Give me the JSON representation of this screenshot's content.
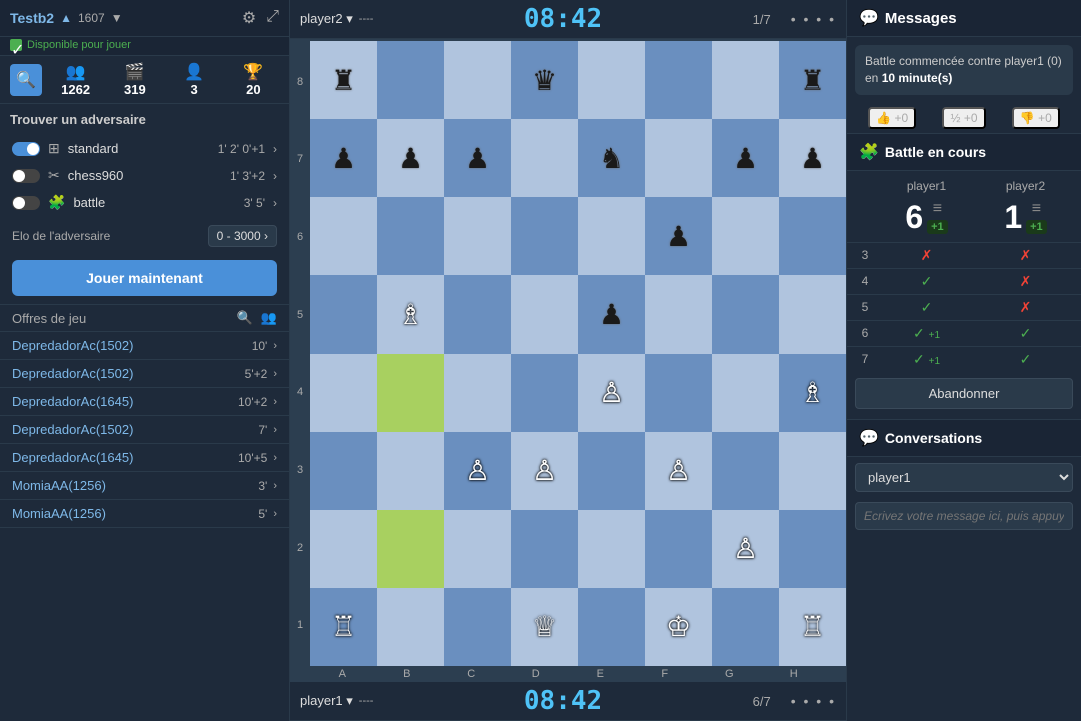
{
  "user": {
    "name": "Testb2",
    "rating": "1607",
    "dropdown_arrow": "▼",
    "available_label": "Disponible pour jouer"
  },
  "stats": [
    {
      "icon": "👥",
      "value": "1262",
      "label": "people"
    },
    {
      "icon": "🎬",
      "value": "319",
      "label": "games"
    },
    {
      "icon": "👤★",
      "value": "3",
      "label": "friends"
    },
    {
      "icon": "🏆",
      "value": "20",
      "label": "trophy"
    }
  ],
  "find_opponent_label": "Trouver un adversaire",
  "game_modes": [
    {
      "enabled": true,
      "icon": "⊞",
      "name": "standard",
      "time": "1'  2'  0'+1",
      "has_arrow": true
    },
    {
      "enabled": false,
      "icon": "✂",
      "name": "chess960",
      "time": "1'  3'+2",
      "has_arrow": true
    },
    {
      "enabled": false,
      "icon": "🧩",
      "name": "battle",
      "time": "3'  5'",
      "has_arrow": true
    }
  ],
  "elo_label": "Elo de l'adversaire",
  "elo_range": "0 - 3000",
  "play_button": "Jouer maintenant",
  "offers_title": "Offres de jeu",
  "offers": [
    {
      "name": "DepredadorAc(1502)",
      "time": "10'",
      "has_arrow": true
    },
    {
      "name": "DepredadorAc(1502)",
      "time": "5'+2",
      "has_arrow": true
    },
    {
      "name": "DepredadorAc(1645)",
      "time": "10'+2",
      "has_arrow": true
    },
    {
      "name": "DepredadorAc(1502)",
      "time": "7'",
      "has_arrow": true
    },
    {
      "name": "DepredadorAc(1645)",
      "time": "10'+5",
      "has_arrow": true
    },
    {
      "name": "MomiaAA(1256)",
      "time": "3'",
      "has_arrow": true
    },
    {
      "name": "MomiaAA(1256)",
      "time": "5'",
      "has_arrow": true
    }
  ],
  "board": {
    "top_player": "player2",
    "bottom_player": "player1",
    "top_timer": "08:42",
    "bottom_timer": "08:42",
    "top_progress": "1/7",
    "bottom_progress": "6/7",
    "top_rating": "----",
    "bottom_rating": "----"
  },
  "messages": {
    "title": "Messages",
    "message": "Battle commencée contre player1 (0) en 10 minute(s)",
    "bold_part": "10 minute(s)",
    "reactions": [
      {
        "icon": "👍",
        "value": "+0"
      },
      {
        "icon": "½",
        "value": "+0"
      },
      {
        "icon": "👎",
        "value": "+0"
      }
    ]
  },
  "battle": {
    "title": "Battle en cours",
    "player1_col": "player1",
    "player2_col": "player2",
    "score1": "6",
    "score2": "1",
    "score1_badge": "+1",
    "score2_badge": "+1",
    "rows": [
      {
        "num": "3",
        "p1": "✗",
        "p2": "✗",
        "p1_color": "red",
        "p2_color": "red"
      },
      {
        "num": "4",
        "p1": "✓",
        "p2": "✗",
        "p1_color": "green",
        "p2_color": "red"
      },
      {
        "num": "5",
        "p1": "✓",
        "p2": "✗",
        "p1_color": "green",
        "p2_color": "red"
      },
      {
        "num": "6",
        "p1": "✓+1",
        "p2": "✓",
        "p1_color": "green",
        "p2_color": "green"
      },
      {
        "num": "7",
        "p1": "✓+1",
        "p2": "✓",
        "p1_color": "green",
        "p2_color": "green"
      }
    ],
    "abandon_button": "Abandonner"
  },
  "conversations": {
    "title": "Conversations",
    "player_option": "player1",
    "input_placeholder": "Ecrivez votre message ici, puis appuyez sur la touche \"Entrée\""
  },
  "board_squares": [
    [
      "♜",
      "",
      "",
      "♛",
      "",
      "",
      "",
      "♜"
    ],
    [
      "♟",
      "♟",
      "♟",
      "",
      "♞",
      "",
      "♟",
      "♟"
    ],
    [
      "",
      "",
      "",
      "",
      "",
      "♟",
      "",
      ""
    ],
    [
      "",
      "♗",
      "",
      "",
      "♟",
      "",
      "",
      ""
    ],
    [
      "",
      "",
      "",
      "",
      "♙",
      "",
      "",
      "♗"
    ],
    [
      "",
      "",
      "♙",
      "♙",
      "",
      "♙",
      "",
      ""
    ],
    [
      "",
      "",
      "",
      "",
      "",
      "",
      "♙",
      ""
    ],
    [
      "♖",
      "",
      "",
      "♕",
      "",
      "♔",
      "",
      "♖"
    ]
  ],
  "highlight_squares": [
    [
      6,
      1
    ],
    [
      4,
      1
    ]
  ],
  "piece_colors": {
    "♜": "black",
    "♛": "black",
    "♟": "black",
    "♞": "black",
    "♖": "white",
    "♕": "white",
    "♙": "white",
    "♗": "white",
    "♔": "white"
  }
}
